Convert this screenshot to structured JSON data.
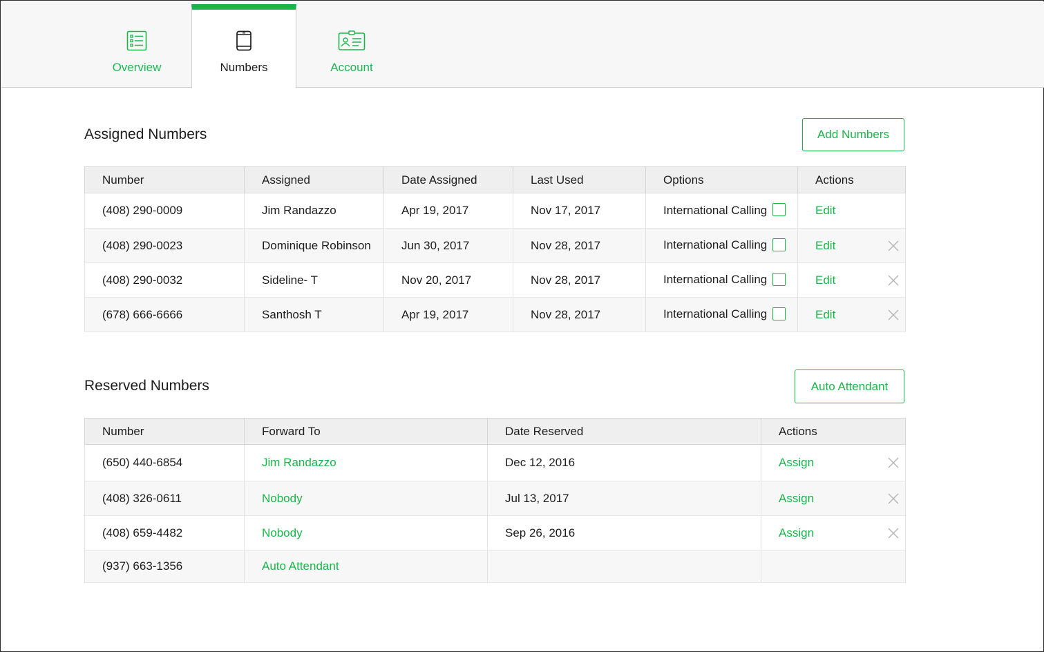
{
  "tabs": [
    {
      "label": "Overview",
      "icon": "list-icon",
      "active": false
    },
    {
      "label": "Numbers",
      "icon": "phone-icon",
      "active": true
    },
    {
      "label": "Account",
      "icon": "id-card-icon",
      "active": false
    }
  ],
  "assigned": {
    "title": "Assigned Numbers",
    "button_label": "Add Numbers",
    "columns": [
      "Number",
      "Assigned",
      "Date Assigned",
      "Last Used",
      "Options",
      "Actions"
    ],
    "rows": [
      {
        "number": "(408) 290-0009",
        "assigned": "Jim Randazzo",
        "date_assigned": "Apr 19, 2017",
        "last_used": "Nov 17, 2017",
        "option": "International Calling",
        "action": "Edit",
        "removable": false
      },
      {
        "number": "(408) 290-0023",
        "assigned": "Dominique Robinson",
        "date_assigned": "Jun 30, 2017",
        "last_used": "Nov 28, 2017",
        "option": "International Calling",
        "action": "Edit",
        "removable": true
      },
      {
        "number": "(408) 290-0032",
        "assigned": "Sideline- T",
        "date_assigned": "Nov 20, 2017",
        "last_used": "Nov 28, 2017",
        "option": "International Calling",
        "action": "Edit",
        "removable": true
      },
      {
        "number": "(678) 666-6666",
        "assigned": "Santhosh T",
        "date_assigned": "Apr 19, 2017",
        "last_used": "Nov 28, 2017",
        "option": "International Calling",
        "action": "Edit",
        "removable": true
      }
    ]
  },
  "reserved": {
    "title": "Reserved Numbers",
    "button_label": "Auto Attendant",
    "columns": [
      "Number",
      "Forward To",
      "Date Reserved",
      "Actions"
    ],
    "rows": [
      {
        "number": "(650) 440-6854",
        "forward_to": "Jim Randazzo",
        "date_reserved": "Dec 12, 2016",
        "action": "Assign",
        "removable": true
      },
      {
        "number": "(408) 326-0611",
        "forward_to": "Nobody",
        "date_reserved": "Jul 13, 2017",
        "action": "Assign",
        "removable": true
      },
      {
        "number": "(408) 659-4482",
        "forward_to": "Nobody",
        "date_reserved": "Sep 26, 2016",
        "action": "Assign",
        "removable": true
      },
      {
        "number": "(937) 663-1356",
        "forward_to": "Auto Attendant",
        "date_reserved": "",
        "action": "",
        "removable": false
      }
    ]
  },
  "colors": {
    "accent": "#1ab54a",
    "header_bg": "#efefef",
    "tabbar_bg": "#f7f7f7"
  }
}
